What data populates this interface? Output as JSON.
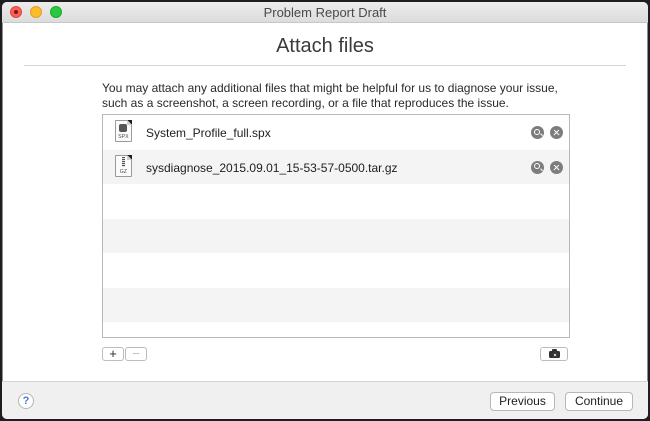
{
  "window": {
    "title": "Problem Report Draft"
  },
  "page": {
    "heading": "Attach files",
    "description": "You may attach any additional files that might be helpful for us to diagnose your issue, such as a screenshot, a screen recording, or a file that reproduces the issue."
  },
  "files": [
    {
      "name": "System_Profile_full.spx",
      "icon": "spx-file-icon",
      "ext": "SPX"
    },
    {
      "name": "sysdiagnose_2015.09.01_15-53-57-0500.tar.gz",
      "icon": "gz-archive-icon",
      "ext": "GZ"
    }
  ],
  "controls": {
    "add_label": "+",
    "remove_label": "−",
    "screenshot_icon": "camera-icon"
  },
  "footer": {
    "help_label": "?",
    "previous_label": "Previous",
    "continue_label": "Continue"
  }
}
